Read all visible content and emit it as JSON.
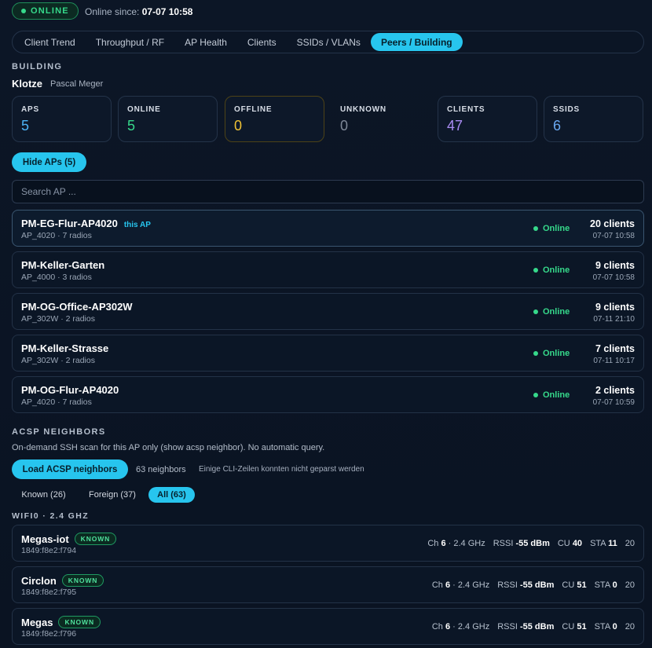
{
  "status": {
    "label": "ONLINE",
    "since_label": "Online since:",
    "since_value": "07-07 10:58"
  },
  "tabs": [
    {
      "label": "Client Trend",
      "active": false
    },
    {
      "label": "Throughput / RF",
      "active": false
    },
    {
      "label": "AP Health",
      "active": false
    },
    {
      "label": "Clients",
      "active": false
    },
    {
      "label": "SSIDs / VLANs",
      "active": false
    },
    {
      "label": "Peers / Building",
      "active": true
    }
  ],
  "building": {
    "section_label": "BUILDING",
    "name": "Klotze",
    "owner": "Pascal Meger",
    "stats": [
      {
        "label": "APS",
        "value": "5",
        "color": "#4db3f5"
      },
      {
        "label": "ONLINE",
        "value": "5",
        "color": "#36d98b"
      },
      {
        "label": "OFFLINE",
        "value": "0",
        "color": "#f0c234"
      },
      {
        "label": "UNKNOWN",
        "value": "0",
        "color": "#7e8897"
      },
      {
        "label": "CLIENTS",
        "value": "47",
        "color": "#a98bf2"
      },
      {
        "label": "SSIDS",
        "value": "6",
        "color": "#6aa8f0"
      }
    ],
    "hide_button": "Hide APs (5)",
    "search_placeholder": "Search AP ..."
  },
  "aps": [
    {
      "name": "PM-EG-Flur-AP4020",
      "tag": "this AP",
      "model": "AP_4020 · 7 radios",
      "status": "Online",
      "clients": "20 clients",
      "time": "07-07 10:58",
      "current": true
    },
    {
      "name": "PM-Keller-Garten",
      "tag": "",
      "model": "AP_4000 · 3 radios",
      "status": "Online",
      "clients": "9 clients",
      "time": "07-07 10:58",
      "current": false
    },
    {
      "name": "PM-OG-Office-AP302W",
      "tag": "",
      "model": "AP_302W · 2 radios",
      "status": "Online",
      "clients": "9 clients",
      "time": "07-11 21:10",
      "current": false
    },
    {
      "name": "PM-Keller-Strasse",
      "tag": "",
      "model": "AP_302W · 2 radios",
      "status": "Online",
      "clients": "7 clients",
      "time": "07-11 10:17",
      "current": false
    },
    {
      "name": "PM-OG-Flur-AP4020",
      "tag": "",
      "model": "AP_4020 · 7 radios",
      "status": "Online",
      "clients": "2 clients",
      "time": "07-07 10:59",
      "current": false
    }
  ],
  "acsp": {
    "section_label": "ACSP NEIGHBORS",
    "description": "On-demand SSH scan for this AP only (show acsp neighbor). No automatic query.",
    "load_button": "Load ACSP neighbors",
    "count": "63 neighbors",
    "warning": "Einige CLI-Zeilen konnten nicht geparst werden",
    "filters": [
      {
        "label": "Known (26)",
        "active": false
      },
      {
        "label": "Foreign (37)",
        "active": false
      },
      {
        "label": "All (63)",
        "active": true
      }
    ],
    "band_label": "WIFI0 · 2.4 GHZ",
    "neighbors": [
      {
        "name": "Megas-iot",
        "badge": "KNOWN",
        "mac": "1849:f8e2:f794",
        "ch_label": "Ch",
        "ch": "6",
        "band": "· 2.4 GHz",
        "rssi_label": "RSSI",
        "rssi": "-55 dBm",
        "cu_label": "CU",
        "cu": "40",
        "sta_label": "STA",
        "sta": "11",
        "extra": "20"
      },
      {
        "name": "Circlon",
        "badge": "KNOWN",
        "mac": "1849:f8e2:f795",
        "ch_label": "Ch",
        "ch": "6",
        "band": "· 2.4 GHz",
        "rssi_label": "RSSI",
        "rssi": "-55 dBm",
        "cu_label": "CU",
        "cu": "51",
        "sta_label": "STA",
        "sta": "0",
        "extra": "20"
      },
      {
        "name": "Megas",
        "badge": "KNOWN",
        "mac": "1849:f8e2:f796",
        "ch_label": "Ch",
        "ch": "6",
        "band": "· 2.4 GHz",
        "rssi_label": "RSSI",
        "rssi": "-55 dBm",
        "cu_label": "CU",
        "cu": "51",
        "sta_label": "STA",
        "sta": "0",
        "extra": "20"
      }
    ]
  }
}
